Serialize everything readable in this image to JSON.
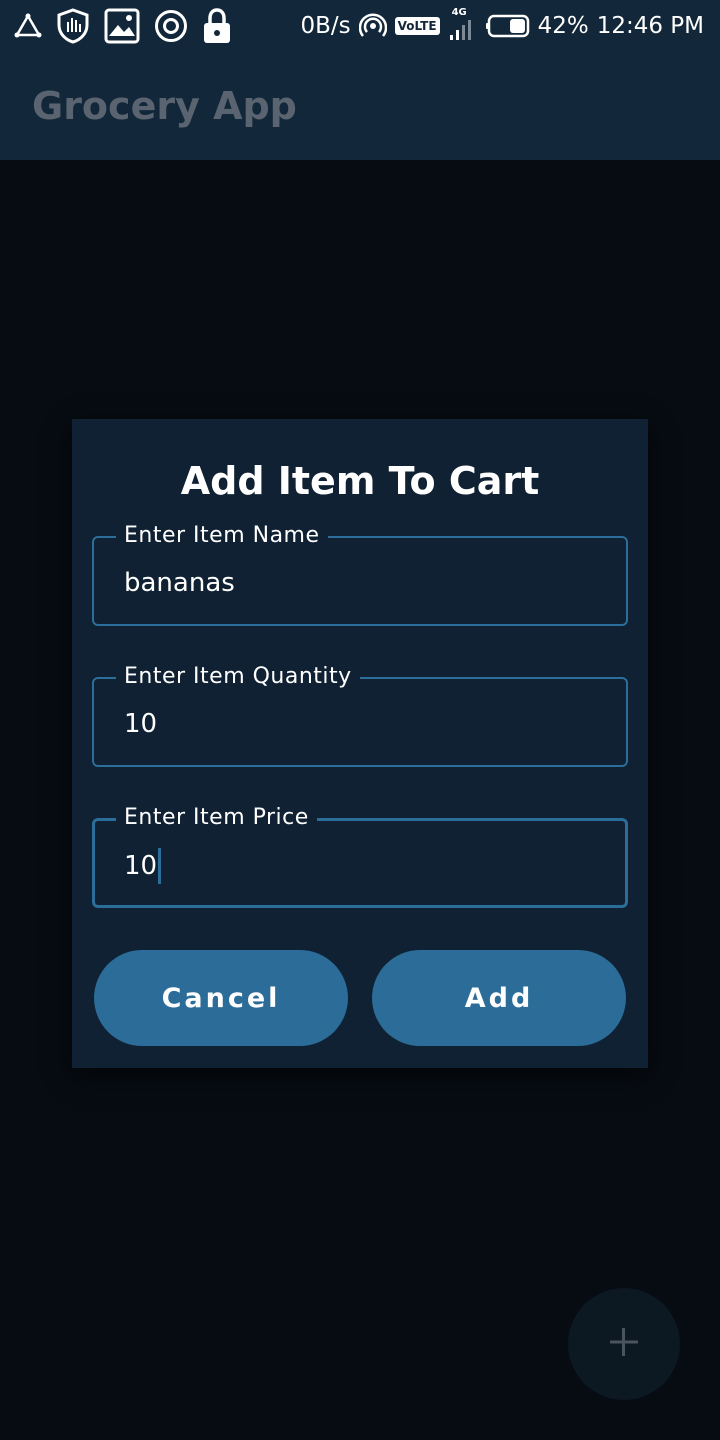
{
  "status_bar": {
    "net_speed": "0B/s",
    "network_type": "4G",
    "volte": "VoLTE",
    "battery": "42%",
    "time": "12:46 PM",
    "icons": [
      "triangle-icon",
      "shield-icon",
      "image-icon",
      "target-icon",
      "lock-icon",
      "hotspot-icon",
      "volte-icon",
      "signal-icon",
      "battery-icon"
    ]
  },
  "toolbar": {
    "title": "Grocery App"
  },
  "dialog": {
    "title": "Add Item To Cart",
    "fields": [
      {
        "label": "Enter Item Name",
        "value": "bananas"
      },
      {
        "label": "Enter Item Quantity",
        "value": "10"
      },
      {
        "label": "Enter Item Price",
        "value": "10"
      }
    ],
    "cancel_label": "Cancel",
    "add_label": "Add"
  },
  "fab": {
    "icon": "plus-icon"
  },
  "colors": {
    "background": "#070c12",
    "toolbar": "#122739",
    "dialog": "#0f2132",
    "accent": "#2b6c98",
    "title_muted": "#5a6470"
  }
}
